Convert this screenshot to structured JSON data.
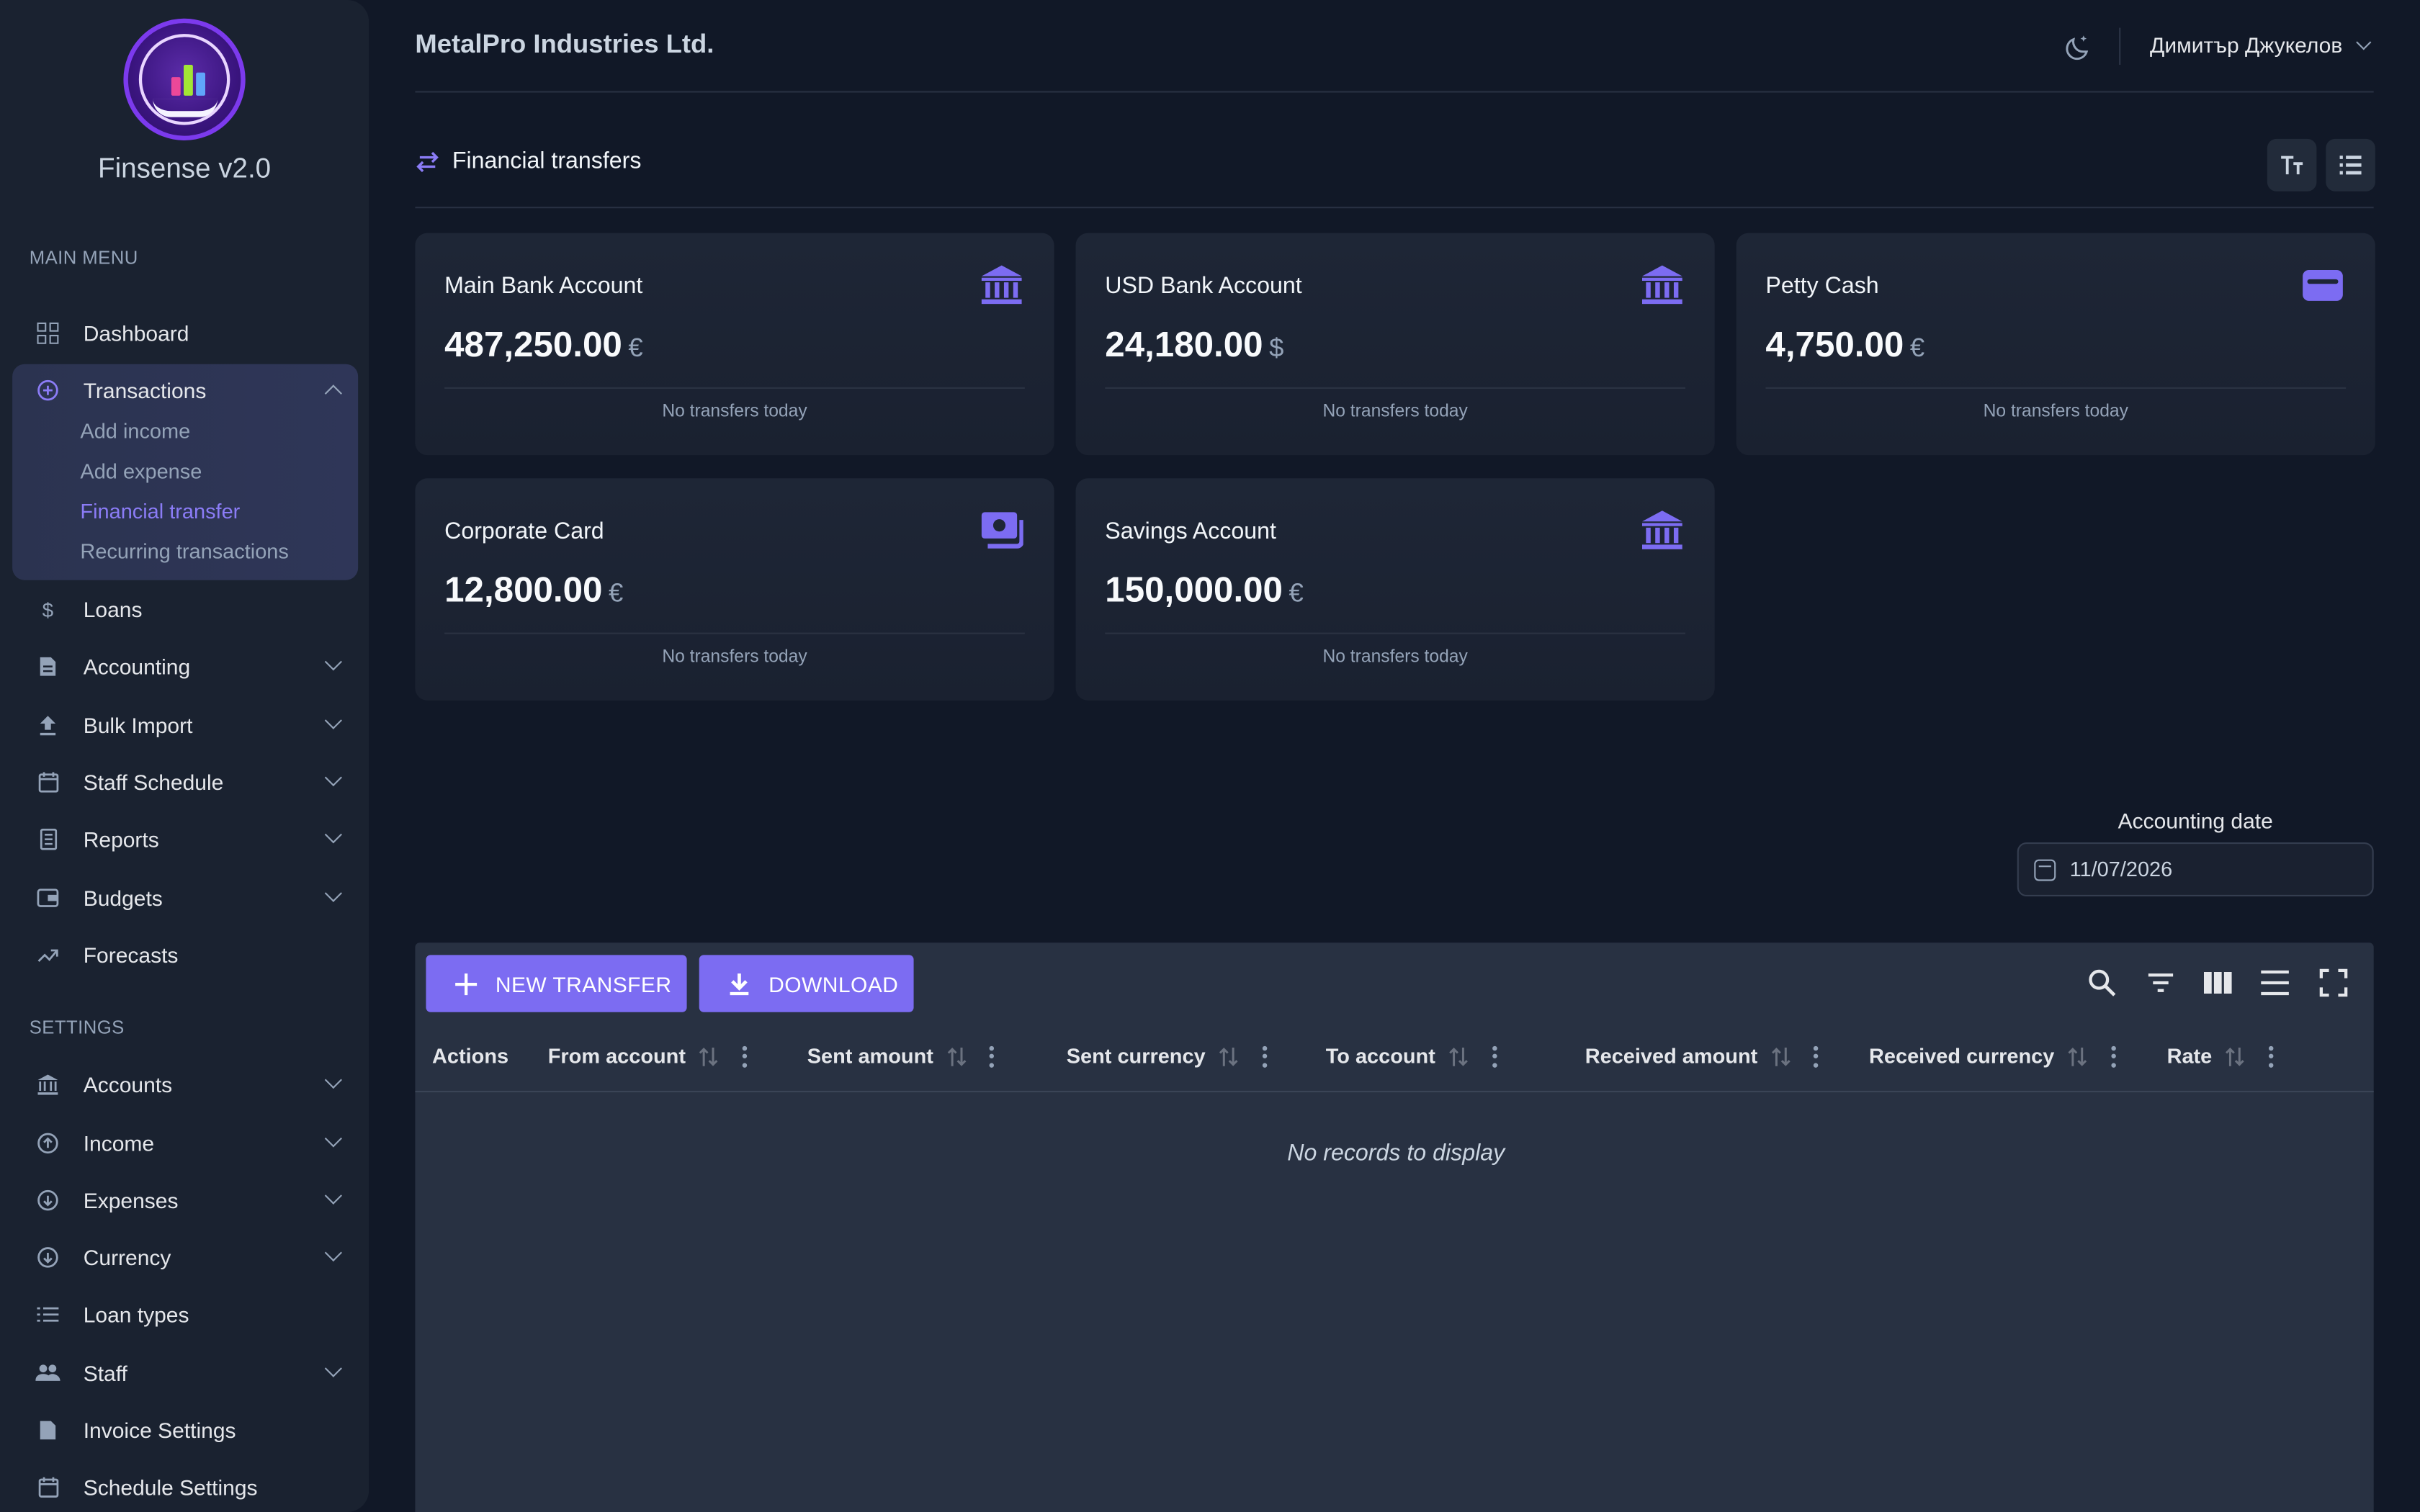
{
  "app": {
    "name": "Finsense v2.0"
  },
  "header": {
    "company": "MetalPro Industries Ltd.",
    "user": "Димитър Джукелов"
  },
  "sidebar": {
    "main_menu_label": "MAIN MENU",
    "settings_label": "SETTINGS",
    "dashboard": "Dashboard",
    "transactions": {
      "label": "Transactions",
      "sub": [
        "Add income",
        "Add expense",
        "Financial transfer",
        "Recurring transactions"
      ]
    },
    "main_items": [
      "Loans",
      "Accounting",
      "Bulk Import",
      "Staff Schedule",
      "Reports",
      "Budgets",
      "Forecasts"
    ],
    "settings_items": [
      "Accounts",
      "Income",
      "Expenses",
      "Currency",
      "Loan types",
      "Staff",
      "Invoice Settings",
      "Schedule Settings"
    ]
  },
  "page": {
    "title": "Financial transfers"
  },
  "cards": [
    {
      "name": "Main Bank Account",
      "amount": "487,250.00",
      "currency": "€",
      "status": "No transfers today",
      "icon": "bank-icon"
    },
    {
      "name": "USD Bank Account",
      "amount": "24,180.00",
      "currency": "$",
      "status": "No transfers today",
      "icon": "bank-icon"
    },
    {
      "name": "Petty Cash",
      "amount": "4,750.00",
      "currency": "€",
      "status": "No transfers today",
      "icon": "wallet-icon"
    },
    {
      "name": "Corporate Card",
      "amount": "12,800.00",
      "currency": "€",
      "status": "No transfers today",
      "icon": "cash-icon"
    },
    {
      "name": "Savings Account",
      "amount": "150,000.00",
      "currency": "€",
      "status": "No transfers today",
      "icon": "bank-icon"
    }
  ],
  "accounting_date": {
    "label": "Accounting date",
    "value": "11/07/2026"
  },
  "table": {
    "new_transfer": "NEW TRANSFER",
    "download": "DOWNLOAD",
    "columns": [
      "Actions",
      "From account",
      "Sent amount",
      "Sent currency",
      "To account",
      "Received amount",
      "Received currency",
      "Rate"
    ],
    "empty": "No records to display"
  },
  "colors": {
    "accent": "#7c6cf2",
    "background": "#111827",
    "sidebar": "#1a2230"
  }
}
